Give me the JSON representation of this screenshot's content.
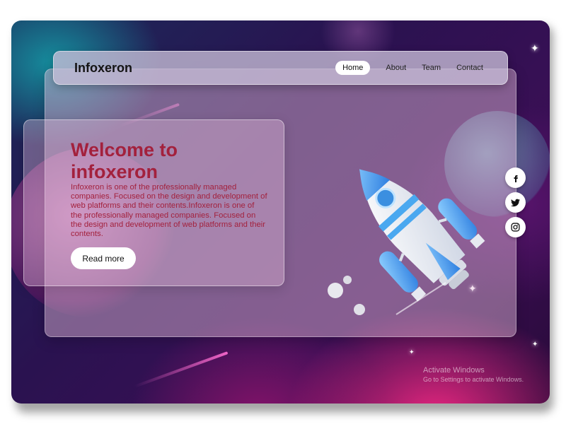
{
  "navbar": {
    "brand": "Infoxeron",
    "items": [
      {
        "label": "Home",
        "active": true
      },
      {
        "label": "About"
      },
      {
        "label": "Team"
      },
      {
        "label": "Contact"
      }
    ]
  },
  "hero": {
    "headline": "Welcome to infoxeron",
    "description": "Infoxeron is one of the professionally managed companies. Focused on the design and development of web platforms and their contents.Infoxeron is one of the professionally managed companies. Focused on the design and development of web platforms and their contents.",
    "button_label": "Read more",
    "illustration": "rocket-illustration"
  },
  "social": [
    {
      "icon": "facebook-icon"
    },
    {
      "icon": "twitter-icon"
    },
    {
      "icon": "instagram-icon"
    }
  ],
  "watermark": {
    "title": "Activate Windows",
    "subtitle": "Go to Settings to activate Windows."
  },
  "colors": {
    "headline": "#a3213d",
    "button_bg": "#ffffff",
    "accent_pink": "#f0288a",
    "accent_teal": "#14a0aa"
  }
}
